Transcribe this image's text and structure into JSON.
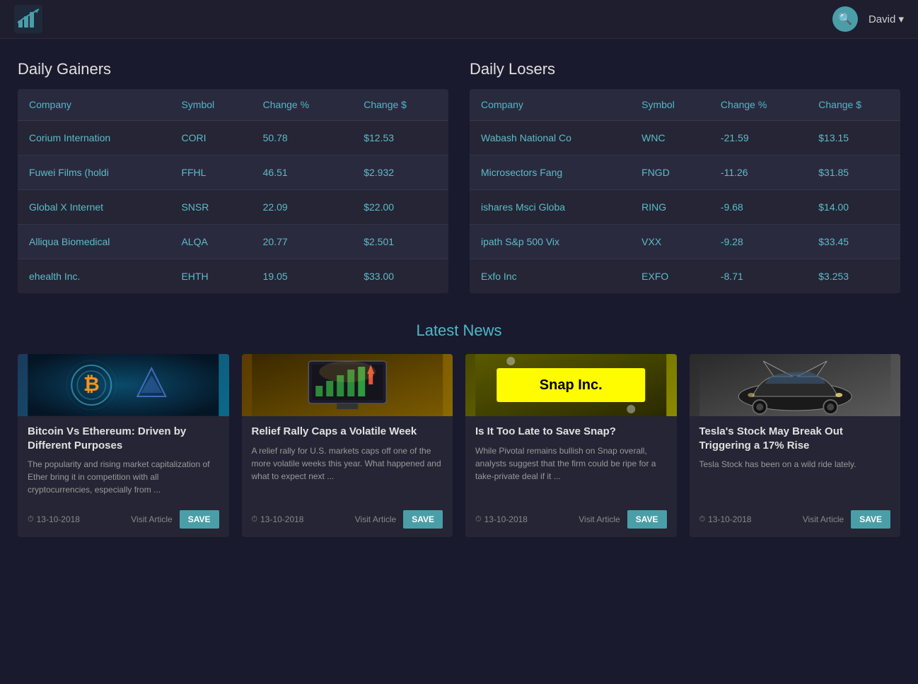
{
  "header": {
    "logo_alt": "Stock App Logo",
    "user_label": "David ▾",
    "search_icon": "🔍"
  },
  "gainers": {
    "title": "Daily Gainers",
    "columns": [
      "Company",
      "Symbol",
      "Change %",
      "Change $"
    ],
    "rows": [
      {
        "company": "Corium Internation",
        "symbol": "CORI",
        "change_pct": "50.78",
        "change_dollar": "$12.53"
      },
      {
        "company": "Fuwei Films (holdi",
        "symbol": "FFHL",
        "change_pct": "46.51",
        "change_dollar": "$2.932"
      },
      {
        "company": "Global X Internet",
        "symbol": "SNSR",
        "change_pct": "22.09",
        "change_dollar": "$22.00"
      },
      {
        "company": "Alliqua Biomedical",
        "symbol": "ALQA",
        "change_pct": "20.77",
        "change_dollar": "$2.501"
      },
      {
        "company": "ehealth Inc.",
        "symbol": "EHTH",
        "change_pct": "19.05",
        "change_dollar": "$33.00"
      }
    ]
  },
  "losers": {
    "title": "Daily Losers",
    "columns": [
      "Company",
      "Symbol",
      "Change %",
      "Change $"
    ],
    "rows": [
      {
        "company": "Wabash National Co",
        "symbol": "WNC",
        "change_pct": "-21.59",
        "change_dollar": "$13.15"
      },
      {
        "company": "Microsectors Fang",
        "symbol": "FNGD",
        "change_pct": "-11.26",
        "change_dollar": "$31.85"
      },
      {
        "company": "ishares Msci Globa",
        "symbol": "RING",
        "change_pct": "-9.68",
        "change_dollar": "$14.00"
      },
      {
        "company": "ipath S&p 500 Vix",
        "symbol": "VXX",
        "change_pct": "-9.28",
        "change_dollar": "$33.45"
      },
      {
        "company": "Exfo Inc",
        "symbol": "EXFO",
        "change_pct": "-8.71",
        "change_dollar": "$3.253"
      }
    ]
  },
  "news": {
    "title": "Latest News",
    "articles": [
      {
        "id": 1,
        "title": "Bitcoin Vs Ethereum: Driven by Different Purposes",
        "description": "The popularity and rising market capitalization of Ether bring it in competition with all cryptocurrencies, especially from ...",
        "date": "13-10-2018",
        "visit_label": "Visit Article",
        "save_label": "SAVE",
        "image_type": "bitcoin"
      },
      {
        "id": 2,
        "title": "Relief Rally Caps a Volatile Week",
        "description": "A relief rally for U.S. markets caps off one of the more volatile weeks this year. What happened and what to expect next ...",
        "date": "13-10-2018",
        "visit_label": "Visit Article",
        "save_label": "SAVE",
        "image_type": "rally"
      },
      {
        "id": 3,
        "title": "Is It Too Late to Save Snap?",
        "description": "While Pivotal remains bullish on Snap overall, analysts suggest that the firm could be ripe for a take-private deal if it ...",
        "date": "13-10-2018",
        "visit_label": "Visit Article",
        "save_label": "SAVE",
        "image_type": "snap"
      },
      {
        "id": 4,
        "title": "Tesla's Stock May Break Out Triggering a 17% Rise",
        "description": "Tesla Stock has been on a wild ride lately.",
        "date": "13-10-2018",
        "visit_label": "Visit Article",
        "save_label": "SAVE",
        "image_type": "tesla"
      }
    ]
  }
}
